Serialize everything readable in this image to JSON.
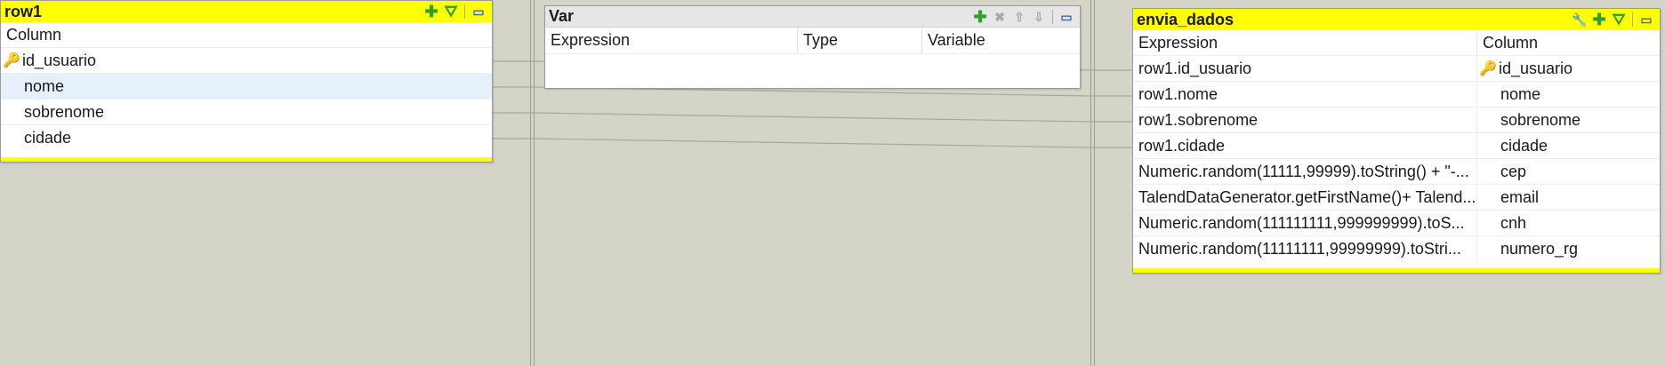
{
  "input_table": {
    "title": "row1",
    "header": "Column",
    "rows": [
      "id_usuario",
      "nome",
      "sobrenome",
      "cidade"
    ]
  },
  "var_table": {
    "title": "Var",
    "headers": [
      "Expression",
      "Type",
      "Variable"
    ]
  },
  "output_table": {
    "title": "envia_dados",
    "headers": [
      "Expression",
      "Column"
    ],
    "rows": [
      {
        "expression": "row1.id_usuario",
        "column": "id_usuario"
      },
      {
        "expression": "row1.nome",
        "column": "nome"
      },
      {
        "expression": "row1.sobrenome",
        "column": "sobrenome"
      },
      {
        "expression": "row1.cidade",
        "column": "cidade"
      },
      {
        "expression": "Numeric.random(11111,99999).toString() + \"-...",
        "column": "cep"
      },
      {
        "expression": "TalendDataGenerator.getFirstName()+ Talend...",
        "column": "email"
      },
      {
        "expression": "Numeric.random(111111111,999999999).toS...",
        "column": "cnh"
      },
      {
        "expression": "Numeric.random(11111111,99999999).toStri...",
        "column": "numero_rg"
      }
    ]
  },
  "icons": {
    "key": "key-icon",
    "add": "add-plus-icon",
    "filter": "filter-add-icon",
    "minimize": "minimize-window-icon",
    "remove": "remove-x-icon",
    "up": "move-up-icon",
    "down": "move-down-icon",
    "settings": "wrench-icon"
  },
  "colors": {
    "title_yellow": "#ffff00",
    "canvas": "#d4d4c8",
    "selected_row": "#e6f0fa"
  }
}
